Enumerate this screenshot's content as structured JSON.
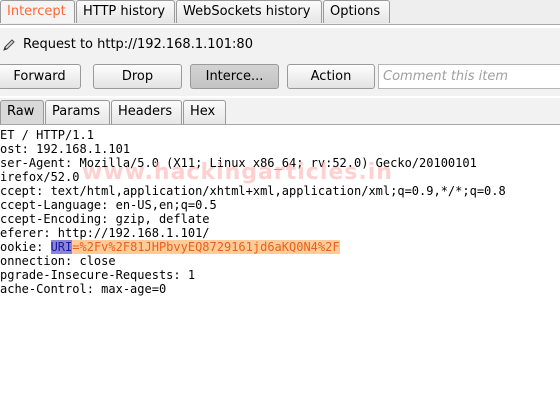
{
  "top_tabs": [
    {
      "label": "Intercept",
      "active": true
    },
    {
      "label": "HTTP history",
      "active": false
    },
    {
      "label": "WebSockets history",
      "active": false
    },
    {
      "label": "Options",
      "active": false
    }
  ],
  "request_line": {
    "label": "Request to http://192.168.1.101:80"
  },
  "buttons": {
    "forward": "Forward",
    "drop": "Drop",
    "intercept": "Interce...",
    "action": "Action"
  },
  "comment": {
    "placeholder": "Comment this item"
  },
  "view_tabs": [
    {
      "label": "Raw",
      "active": true
    },
    {
      "label": "Params",
      "active": false
    },
    {
      "label": "Headers",
      "active": false
    },
    {
      "label": "Hex",
      "active": false
    }
  ],
  "request_lines": [
    "ET / HTTP/1.1",
    "ost: 192.168.1.101",
    "ser-Agent: Mozilla/5.0 (X11; Linux x86_64; rv:52.0) Gecko/20100101",
    "irefox/52.0",
    "ccept: text/html,application/xhtml+xml,application/xml;q=0.9,*/*;q=0.8",
    "ccept-Language: en-US,en;q=0.5",
    "ccept-Encoding: gzip, deflate",
    "eferer: http://192.168.1.101/",
    "ookie: ",
    "onnection: close",
    "pgrade-Insecure-Requests: 1",
    "ache-Control: max-age=0"
  ],
  "cookie": {
    "key": "URI",
    "value": "=%2Fv%2F81JHPbvyEQ8729161jd6aKQ0N4%2F"
  },
  "watermark": "www.hackingarticles.in",
  "colors": {
    "accent": "#ff6633",
    "cookie_key_bg": "#8a85d8",
    "cookie_value_bg": "#ffcc99"
  }
}
